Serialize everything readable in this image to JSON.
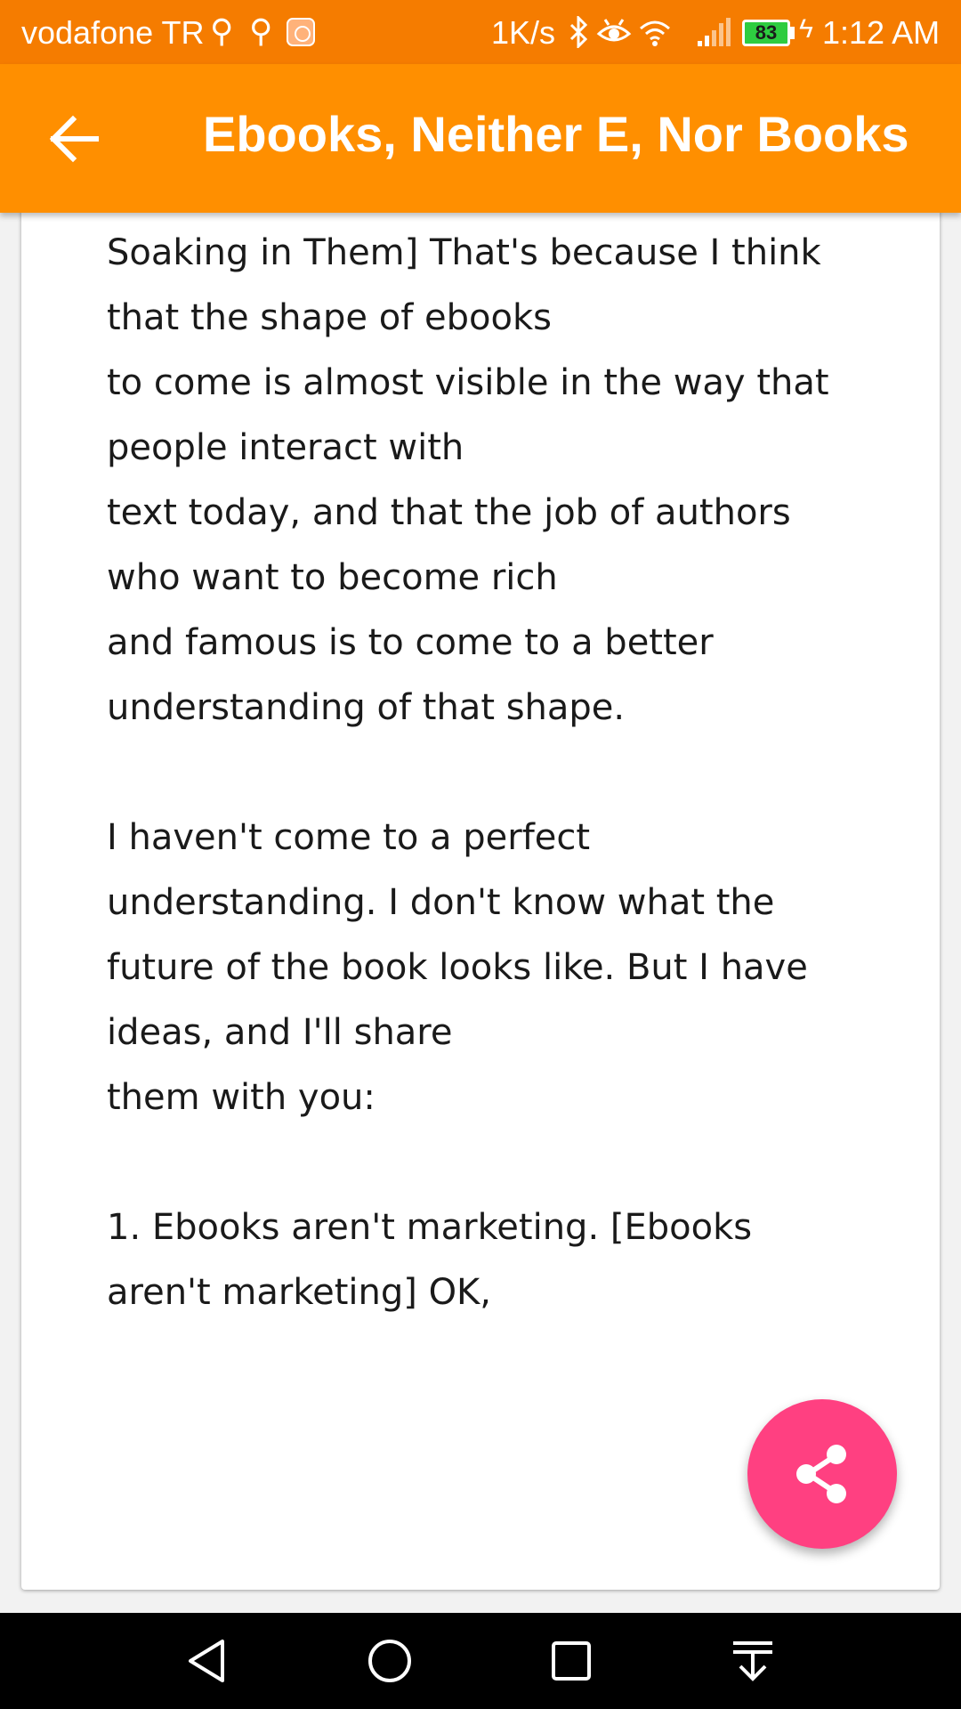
{
  "status_bar": {
    "carrier": "vodafone TR",
    "network_speed": "1K/s",
    "battery_level": "83",
    "time": "1:12 AM",
    "icons": [
      "usb-icon",
      "usb-icon",
      "mi-app-icon",
      "bluetooth-icon",
      "eye-icon",
      "wifi-icon",
      "signal-icon",
      "battery-icon",
      "charging-icon"
    ]
  },
  "app_bar": {
    "title": "Ebooks, Neither E, Nor Books",
    "back_icon": "arrow-back-icon",
    "color": "#ff8f00"
  },
  "article": {
    "lines": [
      "Soaking in Them] That's because I think",
      "that the shape of ebooks",
      "to come is almost visible in the way that",
      "people interact with",
      "text today, and that the job of authors",
      "who want to become rich",
      "and famous is to come to a better",
      "understanding of that shape.",
      "",
      "I haven't come to a perfect",
      "understanding. I don't know what the",
      "future of the book looks like. But I have",
      "ideas, and I'll share",
      "them with you:",
      "",
      "1. Ebooks aren't marketing. [Ebooks",
      "aren't marketing] OK,"
    ]
  },
  "fab": {
    "icon": "share-icon",
    "color": "#ff4081"
  },
  "nav_bar": {
    "buttons": [
      "back-triangle-icon",
      "home-circle-icon",
      "recents-square-icon",
      "notification-pull-icon"
    ]
  }
}
